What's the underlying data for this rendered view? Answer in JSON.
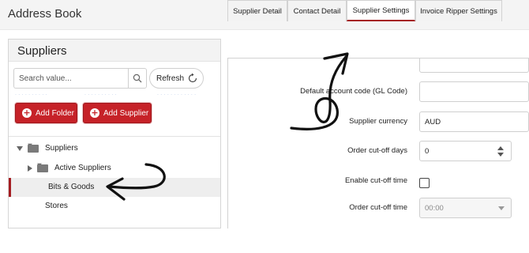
{
  "app": {
    "title": "Address Book"
  },
  "left": {
    "title": "Suppliers",
    "search": {
      "placeholder": "Search value..."
    },
    "refresh_label": "Refresh",
    "add_folder_label": "Add Folder",
    "add_supplier_label": "Add Supplier",
    "tree": [
      {
        "label": "Suppliers",
        "expanded": true
      },
      {
        "label": "Active Suppliers",
        "expanded": false
      },
      {
        "label": "Bits & Goods",
        "selected": true
      },
      {
        "label": "Stores"
      }
    ]
  },
  "tabs": [
    {
      "label": "Supplier Detail"
    },
    {
      "label": "Contact Detail"
    },
    {
      "label": "Supplier Settings",
      "active": true
    },
    {
      "label": "Invoice Ripper Settings"
    }
  ],
  "form": {
    "gl_code_label": "Default account code (GL Code)",
    "gl_code_value": "",
    "currency_label": "Supplier currency",
    "currency_value": "AUD",
    "cutoff_days_label": "Order cut-off days",
    "cutoff_days_value": "0",
    "enable_cutoff_label": "Enable cut-off time",
    "enable_cutoff_checked": false,
    "cutoff_time_label": "Order cut-off time",
    "cutoff_time_value": "00:00"
  },
  "colors": {
    "accent": "#c62228",
    "selected_border": "#a51d22",
    "annotation": "#111111"
  },
  "icons": [
    "search-icon",
    "refresh-icon",
    "plus-circle-icon",
    "folder-icon",
    "caret-down-icon",
    "caret-right-icon",
    "chevron-down-icon"
  ]
}
